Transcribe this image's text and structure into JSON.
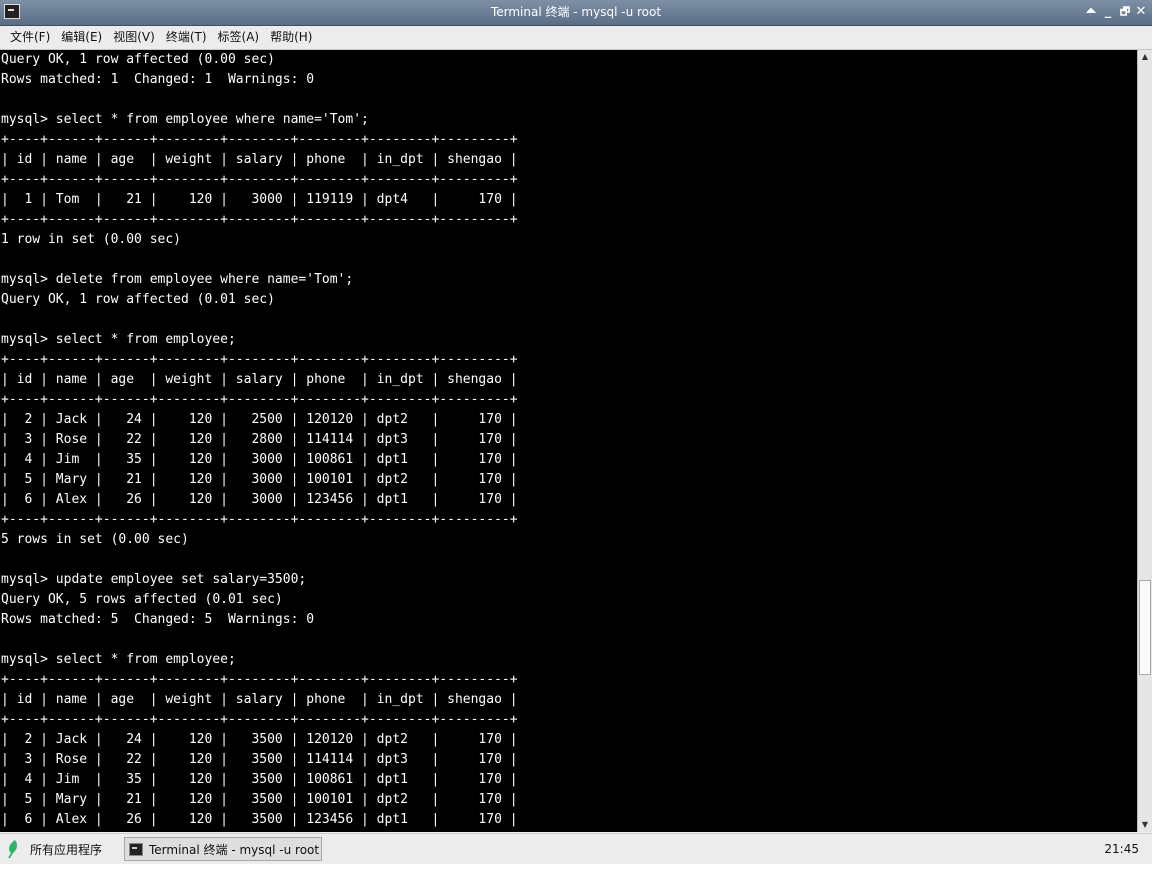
{
  "window": {
    "title": "Terminal 终端 - mysql -u root",
    "controls": [
      "⏶",
      "_",
      "🗗",
      "✕"
    ]
  },
  "menu": [
    "文件(F)",
    "编辑(E)",
    "视图(V)",
    "终端(T)",
    "标签(A)",
    "帮助(H)"
  ],
  "terminal_lines": [
    "Query OK, 1 row affected (0.00 sec)",
    "Rows matched: 1  Changed: 1  Warnings: 0",
    "",
    "mysql> select * from employee where name='Tom';",
    "+----+------+------+--------+--------+--------+--------+---------+",
    "| id | name | age  | weight | salary | phone  | in_dpt | shengao |",
    "+----+------+------+--------+--------+--------+--------+---------+",
    "|  1 | Tom  |   21 |    120 |   3000 | 119119 | dpt4   |     170 |",
    "+----+------+------+--------+--------+--------+--------+---------+",
    "1 row in set (0.00 sec)",
    "",
    "mysql> delete from employee where name='Tom';",
    "Query OK, 1 row affected (0.01 sec)",
    "",
    "mysql> select * from employee;",
    "+----+------+------+--------+--------+--------+--------+---------+",
    "| id | name | age  | weight | salary | phone  | in_dpt | shengao |",
    "+----+------+------+--------+--------+--------+--------+---------+",
    "|  2 | Jack |   24 |    120 |   2500 | 120120 | dpt2   |     170 |",
    "|  3 | Rose |   22 |    120 |   2800 | 114114 | dpt3   |     170 |",
    "|  4 | Jim  |   35 |    120 |   3000 | 100861 | dpt1   |     170 |",
    "|  5 | Mary |   21 |    120 |   3000 | 100101 | dpt2   |     170 |",
    "|  6 | Alex |   26 |    120 |   3000 | 123456 | dpt1   |     170 |",
    "+----+------+------+--------+--------+--------+--------+---------+",
    "5 rows in set (0.00 sec)",
    "",
    "mysql> update employee set salary=3500;",
    "Query OK, 5 rows affected (0.01 sec)",
    "Rows matched: 5  Changed: 5  Warnings: 0",
    "",
    "mysql> select * from employee;",
    "+----+------+------+--------+--------+--------+--------+---------+",
    "| id | name | age  | weight | salary | phone  | in_dpt | shengao |",
    "+----+------+------+--------+--------+--------+--------+---------+",
    "|  2 | Jack |   24 |    120 |   3500 | 120120 | dpt2   |     170 |",
    "|  3 | Rose |   22 |    120 |   3500 | 114114 | dpt3   |     170 |",
    "|  4 | Jim  |   35 |    120 |   3500 | 100861 | dpt1   |     170 |",
    "|  5 | Mary |   21 |    120 |   3500 | 100101 | dpt2   |     170 |",
    "|  6 | Alex |   26 |    120 |   3500 | 123456 | dpt1   |     170 |"
  ],
  "taskbar": {
    "start_label": "所有应用程序",
    "task_label": "Terminal 终端 - mysql -u root",
    "clock": "21:45"
  },
  "colors": {
    "terminal_bg": "#000000",
    "terminal_fg": "#ffffff",
    "titlebar": "#6a7d95",
    "leaf": "#2fb36a"
  }
}
